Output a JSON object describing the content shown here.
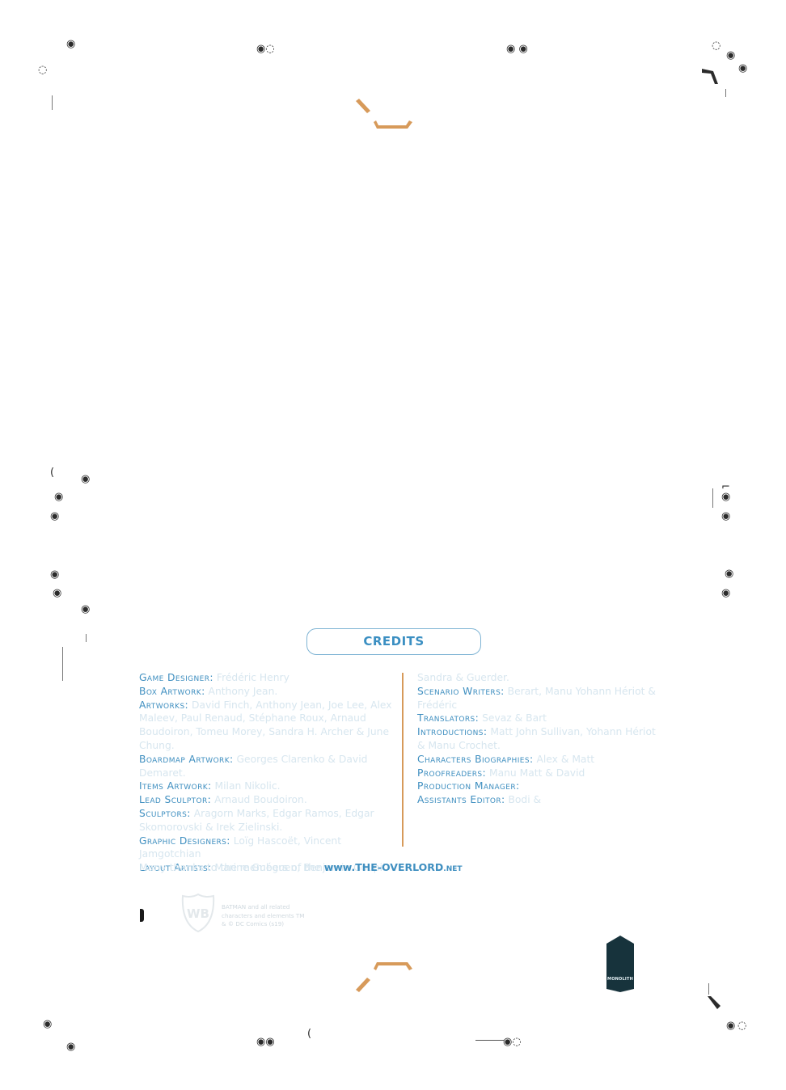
{
  "credits_title": "CREDITS",
  "left_column": [
    {
      "role": "Game Designer:",
      "names": "Frédéric Henry"
    },
    {
      "role": "Box Artwork:",
      "names": "Anthony Jean."
    },
    {
      "role": "Artworks:",
      "names": "David Finch, Anthony Jean, Joe Lee, Alex Maleev, Paul Renaud, Stéphane Roux, Arnaud Boudoiron, Tomeu Morey, Sandra H. Archer & June Chung."
    },
    {
      "role": "Boardmap Artwork:",
      "names": "Georges Clarenko & David Demaret."
    },
    {
      "role": "Items Artwork:",
      "names": "Milan Nikolic."
    },
    {
      "role": "Lead Sculptor:",
      "names": "Arnaud Boudoiron."
    },
    {
      "role": "Sculptors:",
      "names": "Aragorn Marks, Edgar Ramos, Edgar Skomorovski & Irek Zielinski."
    },
    {
      "role": "Graphic Designers:",
      "names": "Loïg Hascoët, Vincent Jamgotchian"
    },
    {
      "role": "Layout Artists:",
      "names": "Marine Guéguen, Benjamin Goupil."
    }
  ],
  "right_column": [
    {
      "role": "",
      "names": "Sandra & Guerder."
    },
    {
      "role": "Scenario Writers:",
      "names": "Berart, Manu Yohann Hériot & Frédéric"
    },
    {
      "role": "Translators:",
      "names": "Sevaz & Bart"
    },
    {
      "role": "Introductions:",
      "names": "Matt John Sullivan, Yohann Hériot & Manu Crochet."
    },
    {
      "role": "Characters Biographies:",
      "names": "Alex & Matt"
    },
    {
      "role": "Proofreaders:",
      "names": "Manu Matt & David"
    },
    {
      "role": "Production Manager:",
      "names": ""
    },
    {
      "role": "Assistants Editor:",
      "names": "Bodi &"
    }
  ],
  "thanks": {
    "text": "Many thanks to the members of the ",
    "site_main": "www.THE-OVERLORD",
    "site_tld": ".NET"
  },
  "legal": "BATMAN and all related characters and elements TM & © DC Comics (s19)",
  "monolith_logo": "MONOLITH",
  "icons": {
    "wb": "wb-shield-logo",
    "monolith": "monolith-logo",
    "ornament": "swirl-ornament-icon"
  },
  "colors": {
    "accent_blue": "#3f8fc0",
    "accent_orange": "#d79a5a",
    "monolith": "#17333c"
  }
}
